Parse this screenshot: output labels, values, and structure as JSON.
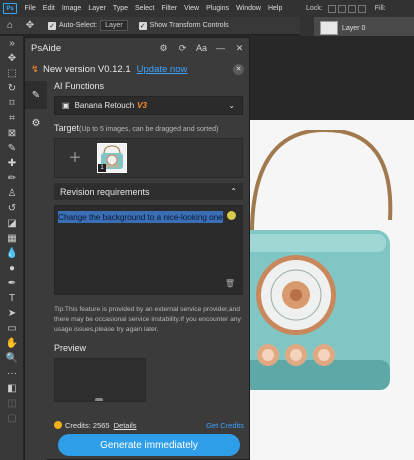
{
  "menubar": {
    "logo": "Ps",
    "items": [
      "File",
      "Edit",
      "Image",
      "Layer",
      "Type",
      "Select",
      "Filter",
      "View",
      "Plugins",
      "Window",
      "Help"
    ]
  },
  "options_bar": {
    "auto_select_label": "Auto-Select:",
    "auto_select_value": "Layer",
    "transform_label": "Show Transform Controls"
  },
  "layers_panel": {
    "lock_label": "Lock:",
    "fill_label": "Fill:",
    "layer_name": "Layer 0",
    "footer_icons": [
      "link-icon",
      "fx-icon",
      "mask-icon",
      "adjustment-icon",
      "folder-icon",
      "new-layer-icon",
      "delete-icon"
    ]
  },
  "plugin": {
    "title": "PsAide",
    "header_icons": [
      "settings-icon",
      "refresh-icon",
      "font-size-icon",
      "minimize-icon",
      "close-icon"
    ],
    "update": {
      "text": "New version V0.12.1",
      "link": "Update now"
    },
    "ai_functions_label": "AI Functions",
    "ai_function_value": "Banana Retouch",
    "ai_function_badge": "V3",
    "target_label": "Target",
    "target_hint": "(Up to 5 images, can be dragged and sorted)",
    "target_count": "1",
    "revision_label": "Revision requirements",
    "revision_text": "Change the background to a nice-looking one",
    "tip": "Tip:This feature is provided by an external service provider,and there may be occasional service instability.If you encounter any usage issues,please try again later.",
    "preview_label": "Preview",
    "credits_text": "Credits: 2565",
    "details_label": "Details",
    "get_credits_label": "Get Credits",
    "generate_label": "Generate immediately"
  },
  "colors": {
    "accent": "#2f9ee9",
    "link": "#3ea2ff",
    "warning": "#ff8a2b",
    "selection": "#3a6fb5"
  }
}
